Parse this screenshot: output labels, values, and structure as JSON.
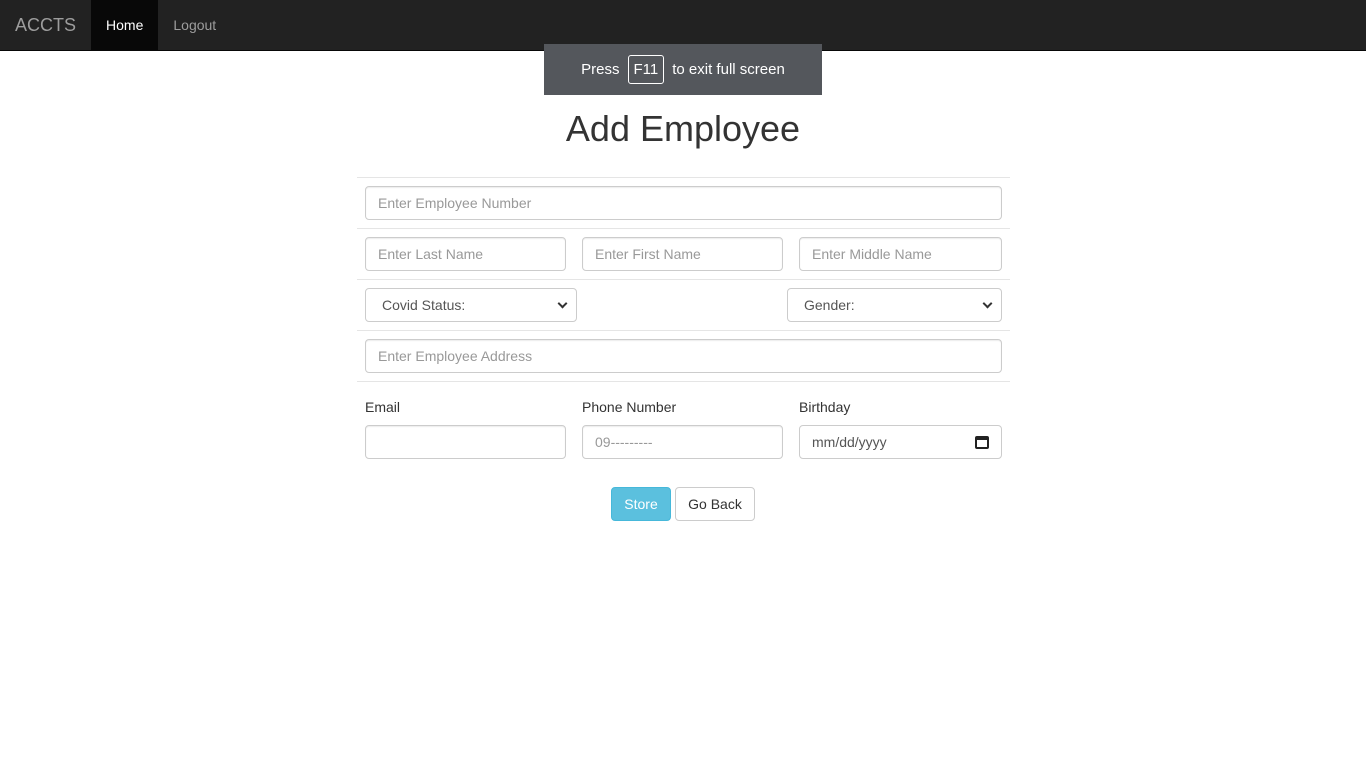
{
  "navbar": {
    "brand": "ACCTS",
    "items": [
      {
        "label": "Home"
      },
      {
        "label": "Logout"
      }
    ]
  },
  "fullscreen_toast": {
    "prefix": "Press",
    "key": "F11",
    "suffix": "to exit full screen"
  },
  "page": {
    "title": "Add Employee"
  },
  "form": {
    "employee_number": {
      "placeholder": "Enter Employee Number"
    },
    "last_name": {
      "placeholder": "Enter Last Name"
    },
    "first_name": {
      "placeholder": "Enter First Name"
    },
    "middle_name": {
      "placeholder": "Enter Middle Name"
    },
    "covid_status": {
      "selected": "Covid Status:"
    },
    "gender": {
      "selected": "Gender:"
    },
    "address": {
      "placeholder": "Enter Employee Address"
    },
    "email": {
      "label": "Email",
      "placeholder": ""
    },
    "phone": {
      "label": "Phone Number",
      "placeholder": "09---------"
    },
    "birthday": {
      "label": "Birthday",
      "value": "mm/dd/yyyy"
    }
  },
  "actions": {
    "store_label": "Store",
    "back_label": "Go Back"
  },
  "colors": {
    "navbar_bg": "#222222",
    "navbar_active_bg": "#080808",
    "store_button": "#5bc0de",
    "toast_bg": "#54575c"
  }
}
